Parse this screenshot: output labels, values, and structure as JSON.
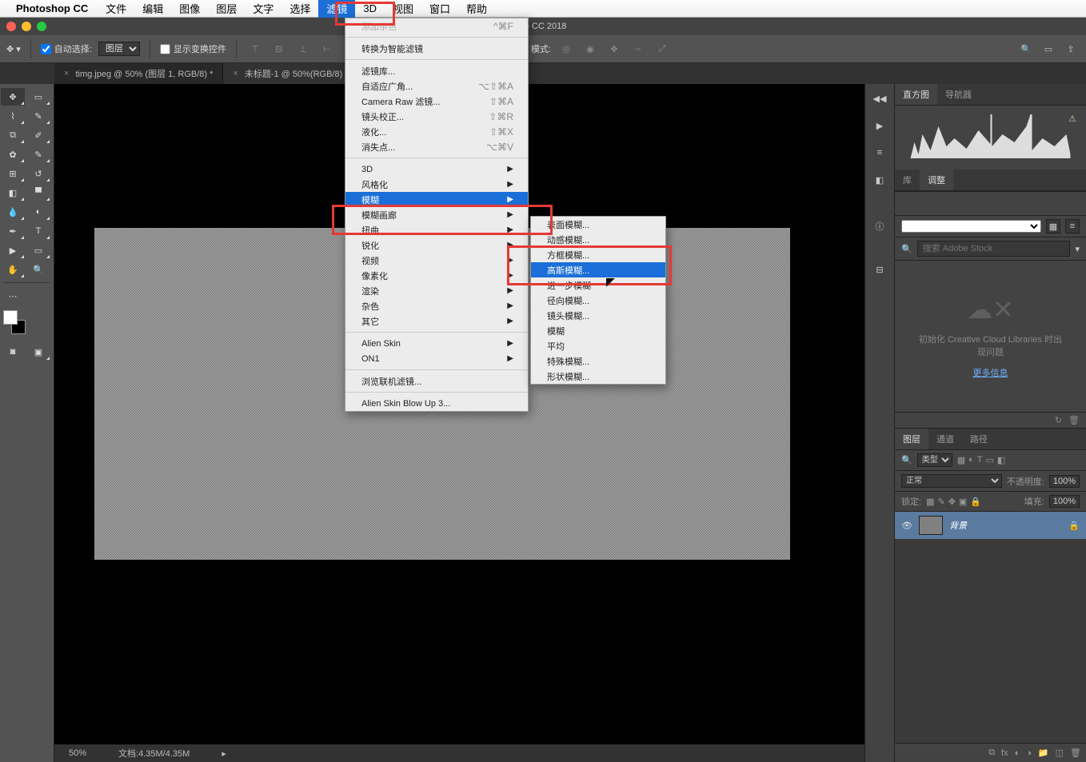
{
  "menubar": {
    "app": "Photoshop CC",
    "items": [
      "文件",
      "编辑",
      "图像",
      "图层",
      "文字",
      "选择",
      "滤镜",
      "3D",
      "视图",
      "窗口",
      "帮助"
    ]
  },
  "window_title": "op CC 2018",
  "optbar": {
    "auto_select": "自动选择:",
    "layer": "图层",
    "show_transform": "显示变换控件",
    "align": "对齐",
    "mode": "模式:"
  },
  "tabs": [
    {
      "label": "timg.jpeg @ 50% (图层 1, RGB/8) *"
    },
    {
      "label": "未标题-1 @ 50%(RGB/8)"
    }
  ],
  "status": {
    "zoom": "50%",
    "doc": "文档:4.35M/4.35M"
  },
  "filter_menu": {
    "add_noise": "添加杂色",
    "add_noise_sc": "^⌘F",
    "smart": "转换为智能滤镜",
    "gallery": "滤镜库...",
    "adaptive": "自适应广角...",
    "adaptive_sc": "⌥⇧⌘A",
    "camera_raw": "Camera Raw 滤镜...",
    "camera_raw_sc": "⇧⌘A",
    "lens": "镜头校正...",
    "lens_sc": "⇧⌘R",
    "liquify": "液化...",
    "liquify_sc": "⇧⌘X",
    "vanish": "消失点...",
    "vanish_sc": "⌥⌘V",
    "g3d": "3D",
    "stylize": "风格化",
    "blur": "模糊",
    "blur_gallery": "模糊画廊",
    "distort": "扭曲",
    "sharpen": "锐化",
    "video": "视频",
    "pixelate": "像素化",
    "render": "渲染",
    "noise": "杂色",
    "other": "其它",
    "alien": "Alien Skin",
    "on1": "ON1",
    "browse": "浏览联机滤镜...",
    "blowup": "Alien Skin Blow Up 3..."
  },
  "blur_menu": {
    "surface": "表面模糊...",
    "motion": "动感模糊...",
    "box": "方框模糊...",
    "gaussian": "高斯模糊...",
    "further": "进一步模糊",
    "radial": "径向模糊...",
    "lens": "镜头模糊...",
    "blur": "模糊",
    "average": "平均",
    "special": "特殊模糊...",
    "shape": "形状模糊..."
  },
  "panels": {
    "histogram": "直方图",
    "navigator": "导航器",
    "lib": "库",
    "adjustments": "调整",
    "stock_placeholder": "搜索 Adobe Stock",
    "cc_msg1": "初始化 Creative Cloud Libraries 时出",
    "cc_msg2": "现问题",
    "cc_link": "更多信息",
    "layers": "图层",
    "channels": "通道",
    "paths": "路径",
    "kind": "类型",
    "normal": "正常",
    "opacity": "不透明度:",
    "opacity_val": "100%",
    "lock": "锁定:",
    "fill": "填充:",
    "fill_val": "100%",
    "bg_layer": "背景"
  }
}
